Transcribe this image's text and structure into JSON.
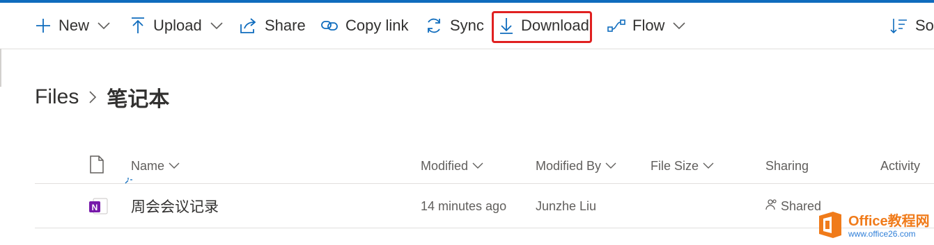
{
  "commandbar": {
    "new_label": "New",
    "upload_label": "Upload",
    "share_label": "Share",
    "copy_link_label": "Copy link",
    "sync_label": "Sync",
    "download_label": "Download",
    "flow_label": "Flow",
    "sort_label": "Sort"
  },
  "breadcrumb": {
    "root": "Files",
    "current": "笔记本"
  },
  "table": {
    "columns": {
      "name": "Name",
      "modified": "Modified",
      "modified_by": "Modified By",
      "file_size": "File Size",
      "sharing": "Sharing",
      "activity": "Activity"
    },
    "rows": [
      {
        "name": "周会会议记录",
        "modified": "14 minutes ago",
        "modified_by": "Junzhe Liu",
        "file_size": "",
        "sharing": "Shared",
        "file_icon": "onenote-icon"
      }
    ]
  },
  "watermark": {
    "brand": "Office教程网",
    "url": "www.office26.com"
  },
  "colors": {
    "accent": "#0f6cbd",
    "highlight": "#e02020",
    "onenote": "#7719aa",
    "watermark_orange": "#f07b1a",
    "watermark_blue": "#2f7fd8"
  }
}
